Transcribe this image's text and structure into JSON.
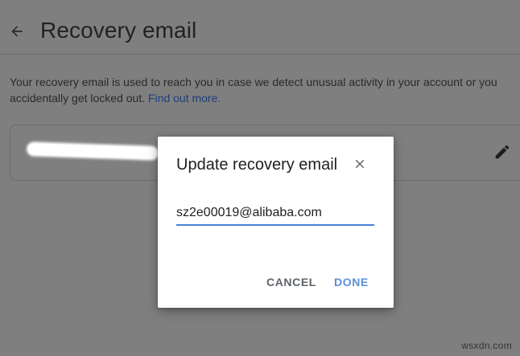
{
  "page": {
    "title": "Recovery email",
    "description": "Your recovery email is used to reach you in case we detect unusual activity in your account or you accidentally get locked out.",
    "learn_more_link": "Find out more."
  },
  "card": {
    "email_redacted": true
  },
  "dialog": {
    "title": "Update recovery email",
    "email_value": "sz2e00019@alibaba.com",
    "cancel_label": "CANCEL",
    "done_label": "DONE"
  },
  "watermark": "wsxdn.com",
  "icons": {
    "back": "arrow-back-icon",
    "edit": "pencil-icon",
    "close": "close-icon"
  },
  "colors": {
    "overlay": "#7f7f7f",
    "accent": "#4a7fd6",
    "done_text": "#5b8fd6",
    "link": "#1f3d7a"
  }
}
